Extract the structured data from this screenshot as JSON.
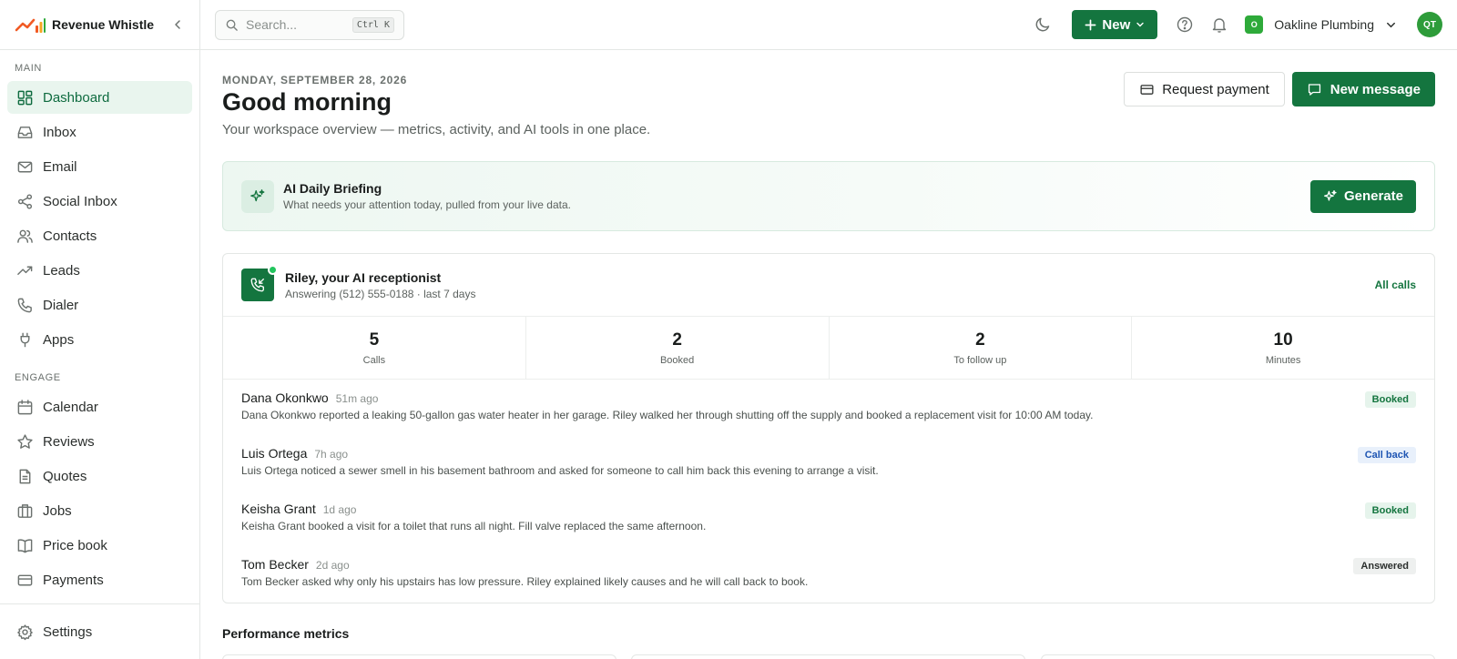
{
  "brand": {
    "name": "Revenue Whistle",
    "logo_icon": "chart-logo-icon",
    "colors": {
      "accent": "#14753f",
      "logo_orange": "#f15a24",
      "logo_green": "#2eaa3a"
    }
  },
  "sidebar": {
    "main_label": "MAIN",
    "main_items": [
      {
        "label": "Dashboard",
        "icon": "grid-icon",
        "active": true
      },
      {
        "label": "Inbox",
        "icon": "inbox-icon"
      },
      {
        "label": "Email",
        "icon": "mail-icon"
      },
      {
        "label": "Social Inbox",
        "icon": "share-icon"
      },
      {
        "label": "Contacts",
        "icon": "users-icon"
      },
      {
        "label": "Leads",
        "icon": "trending-up-icon"
      },
      {
        "label": "Dialer",
        "icon": "phone-icon"
      },
      {
        "label": "Apps",
        "icon": "plug-icon"
      }
    ],
    "engage_label": "ENGAGE",
    "engage_items": [
      {
        "label": "Calendar",
        "icon": "calendar-icon"
      },
      {
        "label": "Reviews",
        "icon": "star-icon"
      },
      {
        "label": "Quotes",
        "icon": "document-icon"
      },
      {
        "label": "Jobs",
        "icon": "briefcase-icon"
      },
      {
        "label": "Price book",
        "icon": "book-icon"
      },
      {
        "label": "Payments",
        "icon": "credit-card-icon"
      }
    ],
    "settings_label": "Settings"
  },
  "topbar": {
    "search_placeholder": "Search...",
    "search_shortcut": "Ctrl K",
    "new_label": "New",
    "org_initial": "O",
    "org_name": "Oakline Plumbing",
    "user_initials": "QT"
  },
  "header": {
    "date": "MONDAY, SEPTEMBER 28, 2026",
    "greeting": "Good morning",
    "subtitle": "Your workspace overview — metrics, activity, and AI tools in one place.",
    "request_payment_label": "Request payment",
    "new_message_label": "New message"
  },
  "briefing": {
    "title": "AI Daily Briefing",
    "subtitle": "What needs your attention today, pulled from your live data.",
    "generate_label": "Generate"
  },
  "receptionist": {
    "title": "Riley, your AI receptionist",
    "subtitle": "Answering (512) 555-0188 · last 7 days",
    "all_calls_label": "All calls",
    "stats": [
      {
        "value": "5",
        "label": "Calls"
      },
      {
        "value": "2",
        "label": "Booked"
      },
      {
        "value": "2",
        "label": "To follow up"
      },
      {
        "value": "10",
        "label": "Minutes"
      }
    ],
    "calls": [
      {
        "name": "Dana Okonkwo",
        "time": "51m ago",
        "summary": "Dana Okonkwo reported a leaking 50-gallon gas water heater in her garage. Riley walked her through shutting off the supply and booked a replacement visit for 10:00 AM today.",
        "status": "Booked",
        "status_type": "booked"
      },
      {
        "name": "Luis Ortega",
        "time": "7h ago",
        "summary": "Luis Ortega noticed a sewer smell in his basement bathroom and asked for someone to call him back this evening to arrange a visit.",
        "status": "Call back",
        "status_type": "callback"
      },
      {
        "name": "Keisha Grant",
        "time": "1d ago",
        "summary": "Keisha Grant booked a visit for a toilet that runs all night. Fill valve replaced the same afternoon.",
        "status": "Booked",
        "status_type": "booked"
      },
      {
        "name": "Tom Becker",
        "time": "2d ago",
        "summary": "Tom Becker asked why only his upstairs has low pressure. Riley explained likely causes and he will call back to book.",
        "status": "Answered",
        "status_type": "answered"
      }
    ]
  },
  "performance": {
    "title": "Performance metrics"
  }
}
